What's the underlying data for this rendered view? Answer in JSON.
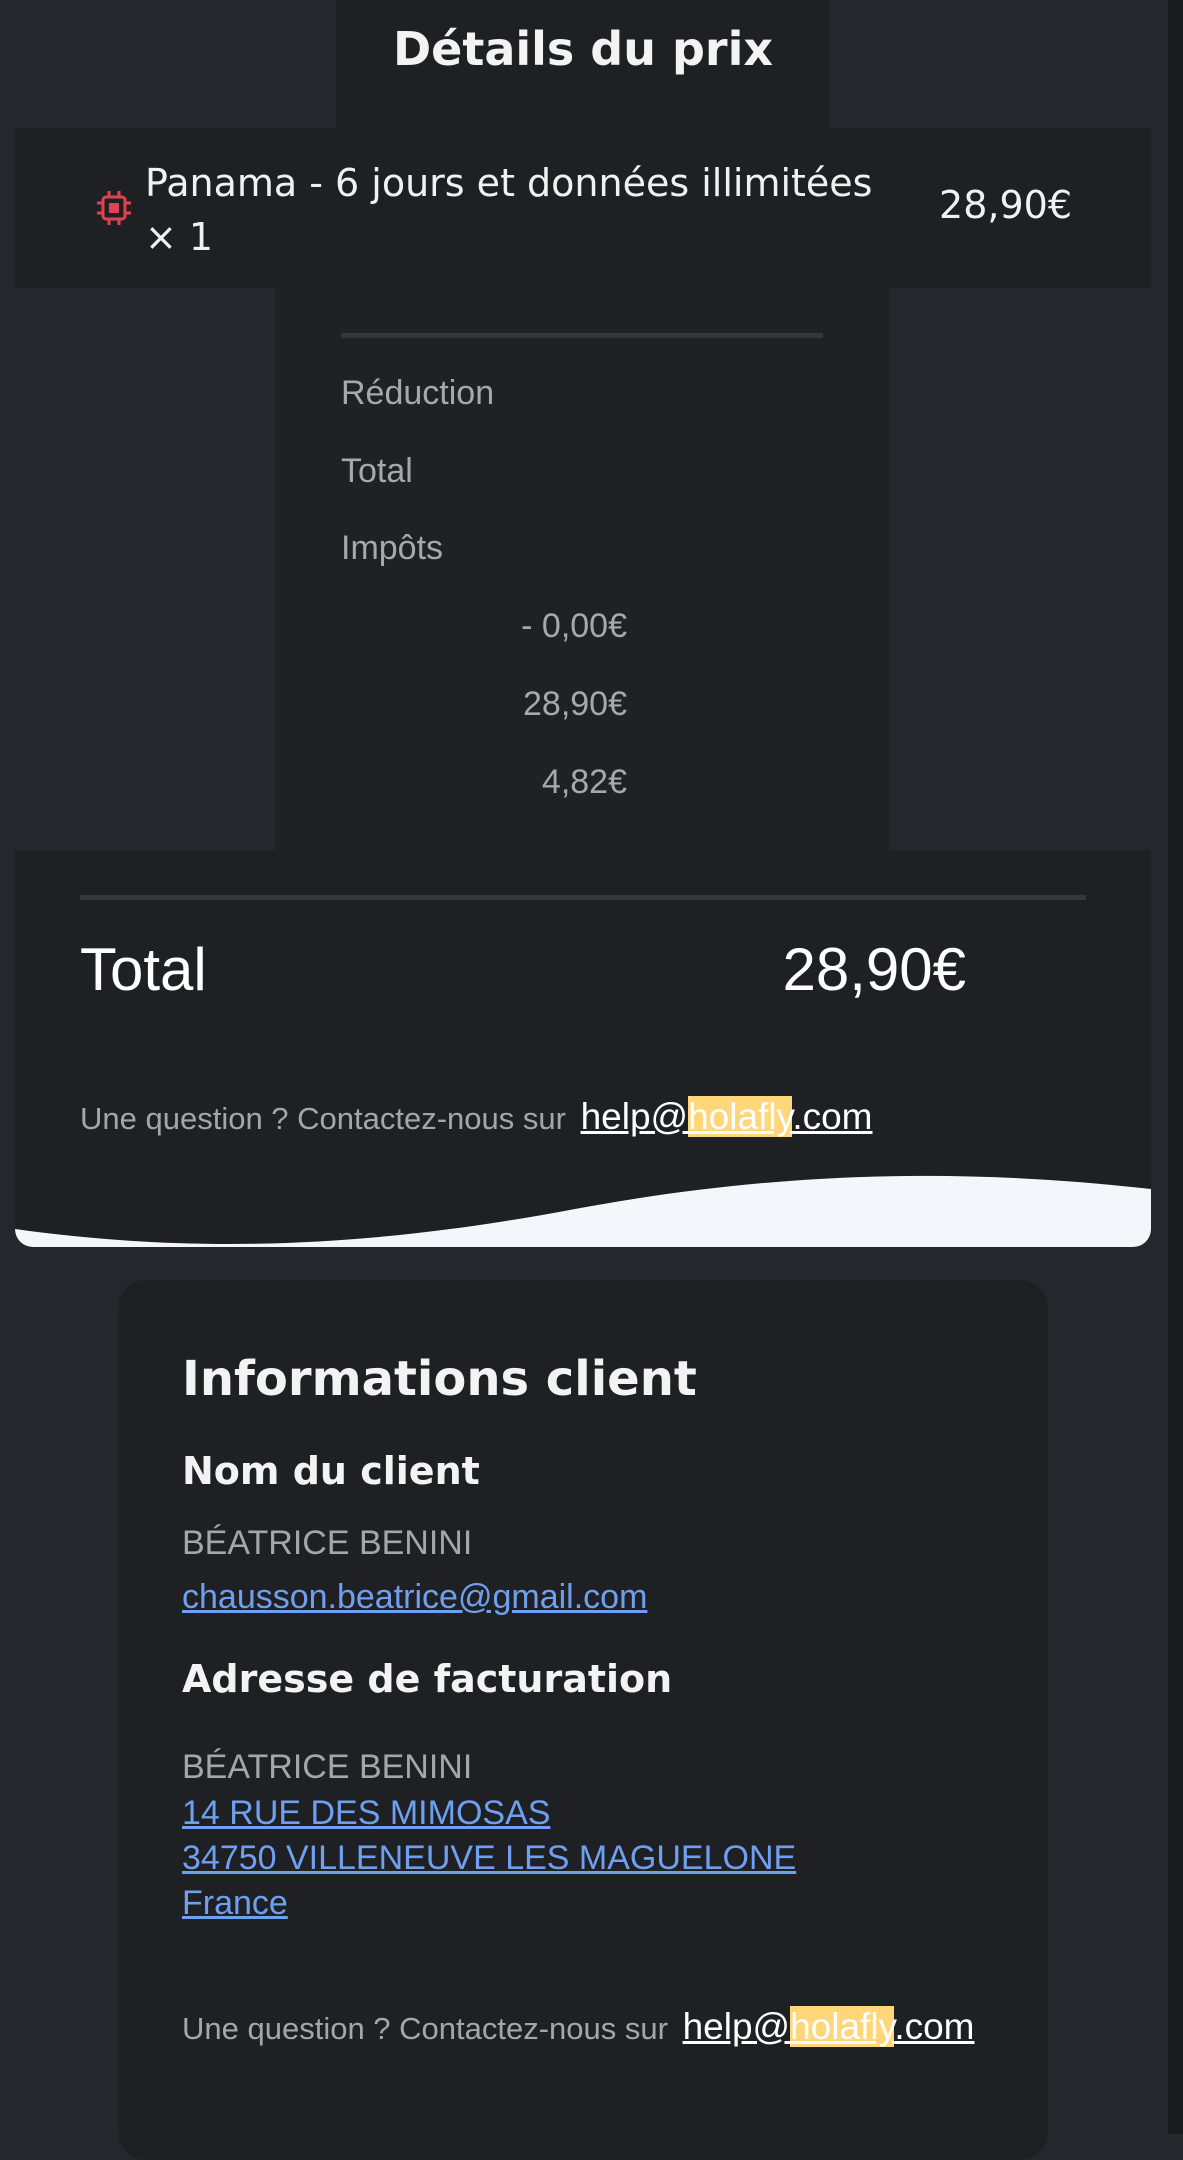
{
  "price_details": {
    "title": "Détails du prix",
    "product": {
      "icon": "chip-icon",
      "name": "Panama - 6 jours et données illimitées",
      "quantity": "× 1",
      "price": "28,90€"
    },
    "summary": {
      "discount_label": "Réduction",
      "total_label": "Total",
      "tax_label": "Impôts",
      "discount_value": "- 0,00€",
      "total_value": "28,90€",
      "tax_value": "4,82€"
    },
    "grand_total": {
      "label": "Total",
      "value": "28,90€"
    },
    "help": {
      "text": "Une question ? Contactez-nous sur",
      "email_prefix": "help@",
      "email_highlight": "holafly",
      "email_suffix": ".com"
    }
  },
  "client_info": {
    "title": "Informations client",
    "name_heading": "Nom du client",
    "name": "BÉATRICE BENINI",
    "email": "chausson.beatrice@gmail.com",
    "billing_heading": "Adresse de facturation",
    "billing_name": "BÉATRICE BENINI",
    "address_line1": "14 RUE DES MIMOSAS",
    "address_line2": "34750 VILLENEUVE LES MAGUELONE",
    "country": "France",
    "help": {
      "text": "Une question ? Contactez-nous sur",
      "email_prefix": "help@",
      "email_highlight": "holafly",
      "email_suffix": ".com"
    }
  },
  "colors": {
    "background": "#25272c",
    "card": "#1f2024",
    "icon_red": "#e0424f",
    "link_blue": "#6fa0ef",
    "highlight": "#ffd77a",
    "wave": "#f3f6fa"
  }
}
